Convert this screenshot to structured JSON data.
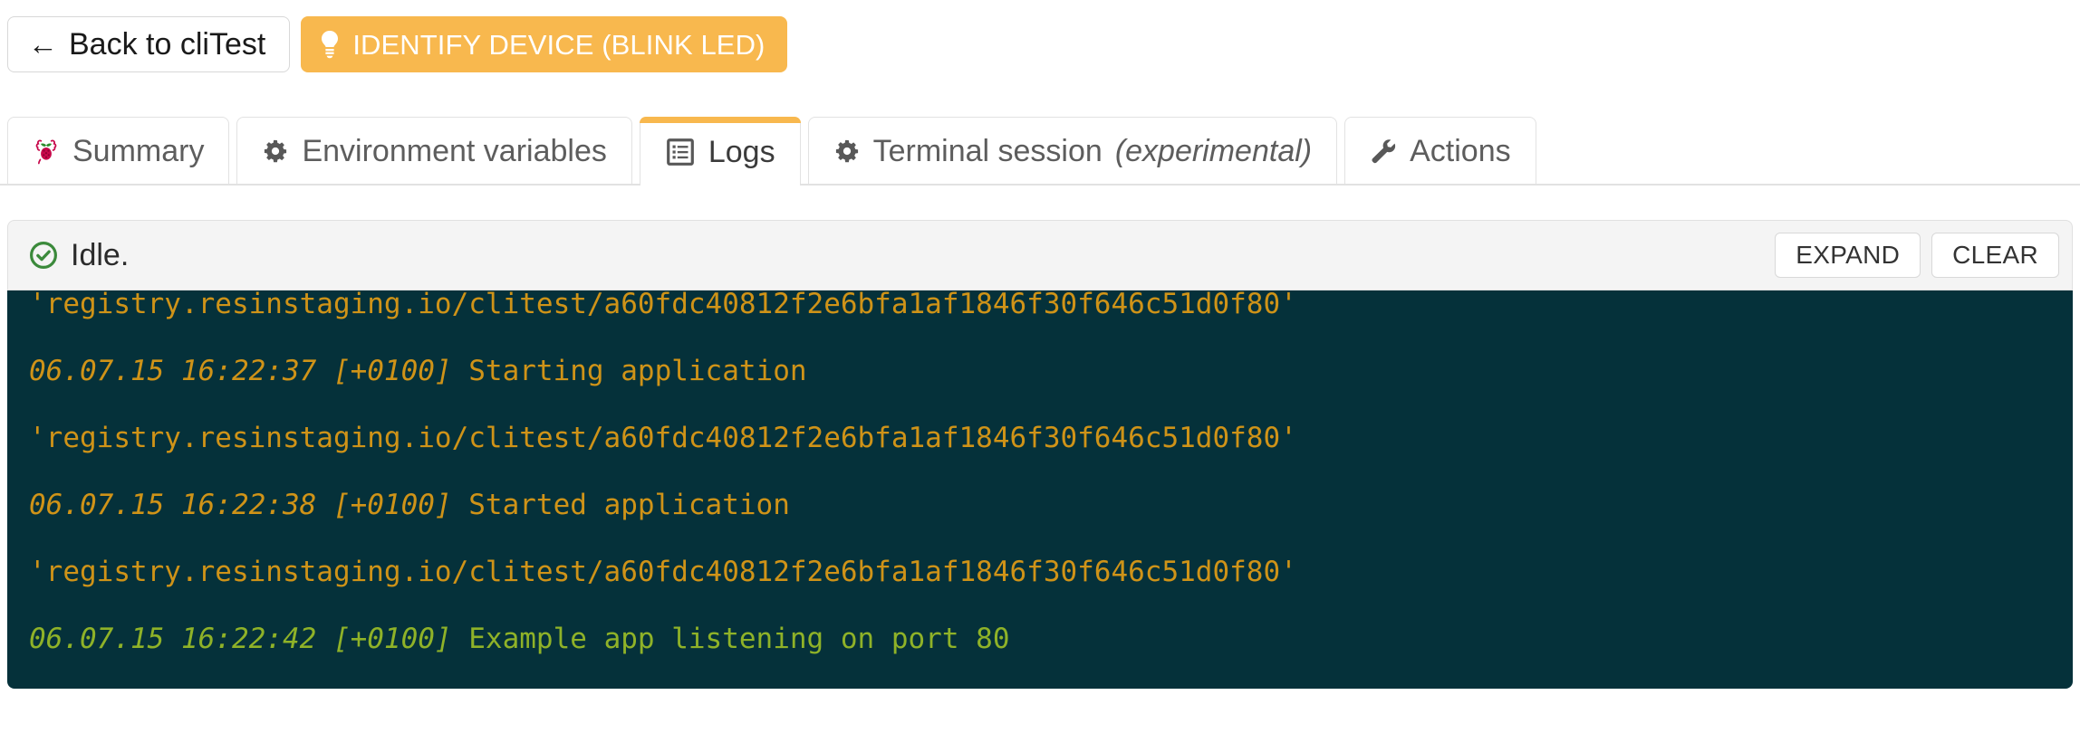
{
  "toolbar": {
    "back_label": "Back to cliTest",
    "back_arrow": "←",
    "back_icon": "arrow-left-icon",
    "identify_label": "IDENTIFY DEVICE (BLINK LED)",
    "identify_icon": "lightbulb-icon",
    "identify_color": "#f8b84e"
  },
  "tabs": [
    {
      "label": "Summary",
      "icon": "raspberry-pi-icon",
      "active": false
    },
    {
      "label": "Environment variables",
      "icon": "gear-icon",
      "active": false
    },
    {
      "label": "Logs",
      "icon": "list-document-icon",
      "active": true
    },
    {
      "label": "Terminal session",
      "suffix": "(experimental)",
      "icon": "gear-icon",
      "active": false
    },
    {
      "label": "Actions",
      "icon": "wrench-icon",
      "active": false
    }
  ],
  "status": {
    "icon": "check-circle-icon",
    "icon_color": "#3b8a3b",
    "text": "Idle.",
    "expand_label": "EXPAND",
    "clear_label": "CLEAR"
  },
  "console": {
    "background": "#05313a",
    "amber": "#cf9318",
    "green": "#8fb228",
    "lines": [
      {
        "text": "'registry.resinstaging.io/clitest/a60fdc40812f2e6bfa1af1846f30f646c51d0f80'",
        "color": "amber",
        "clipped": true
      },
      {
        "timestamp": "06.07.15 16:22:37 [+0100] ",
        "message": "Starting application",
        "color": "amber"
      },
      {
        "text": "'registry.resinstaging.io/clitest/a60fdc40812f2e6bfa1af1846f30f646c51d0f80'",
        "color": "amber"
      },
      {
        "timestamp": "06.07.15 16:22:38 [+0100] ",
        "message": "Started application",
        "color": "amber"
      },
      {
        "text": "'registry.resinstaging.io/clitest/a60fdc40812f2e6bfa1af1846f30f646c51d0f80'",
        "color": "amber"
      },
      {
        "timestamp": "06.07.15 16:22:42 [+0100] ",
        "message": "Example app listening on port 80",
        "color": "green"
      }
    ]
  }
}
